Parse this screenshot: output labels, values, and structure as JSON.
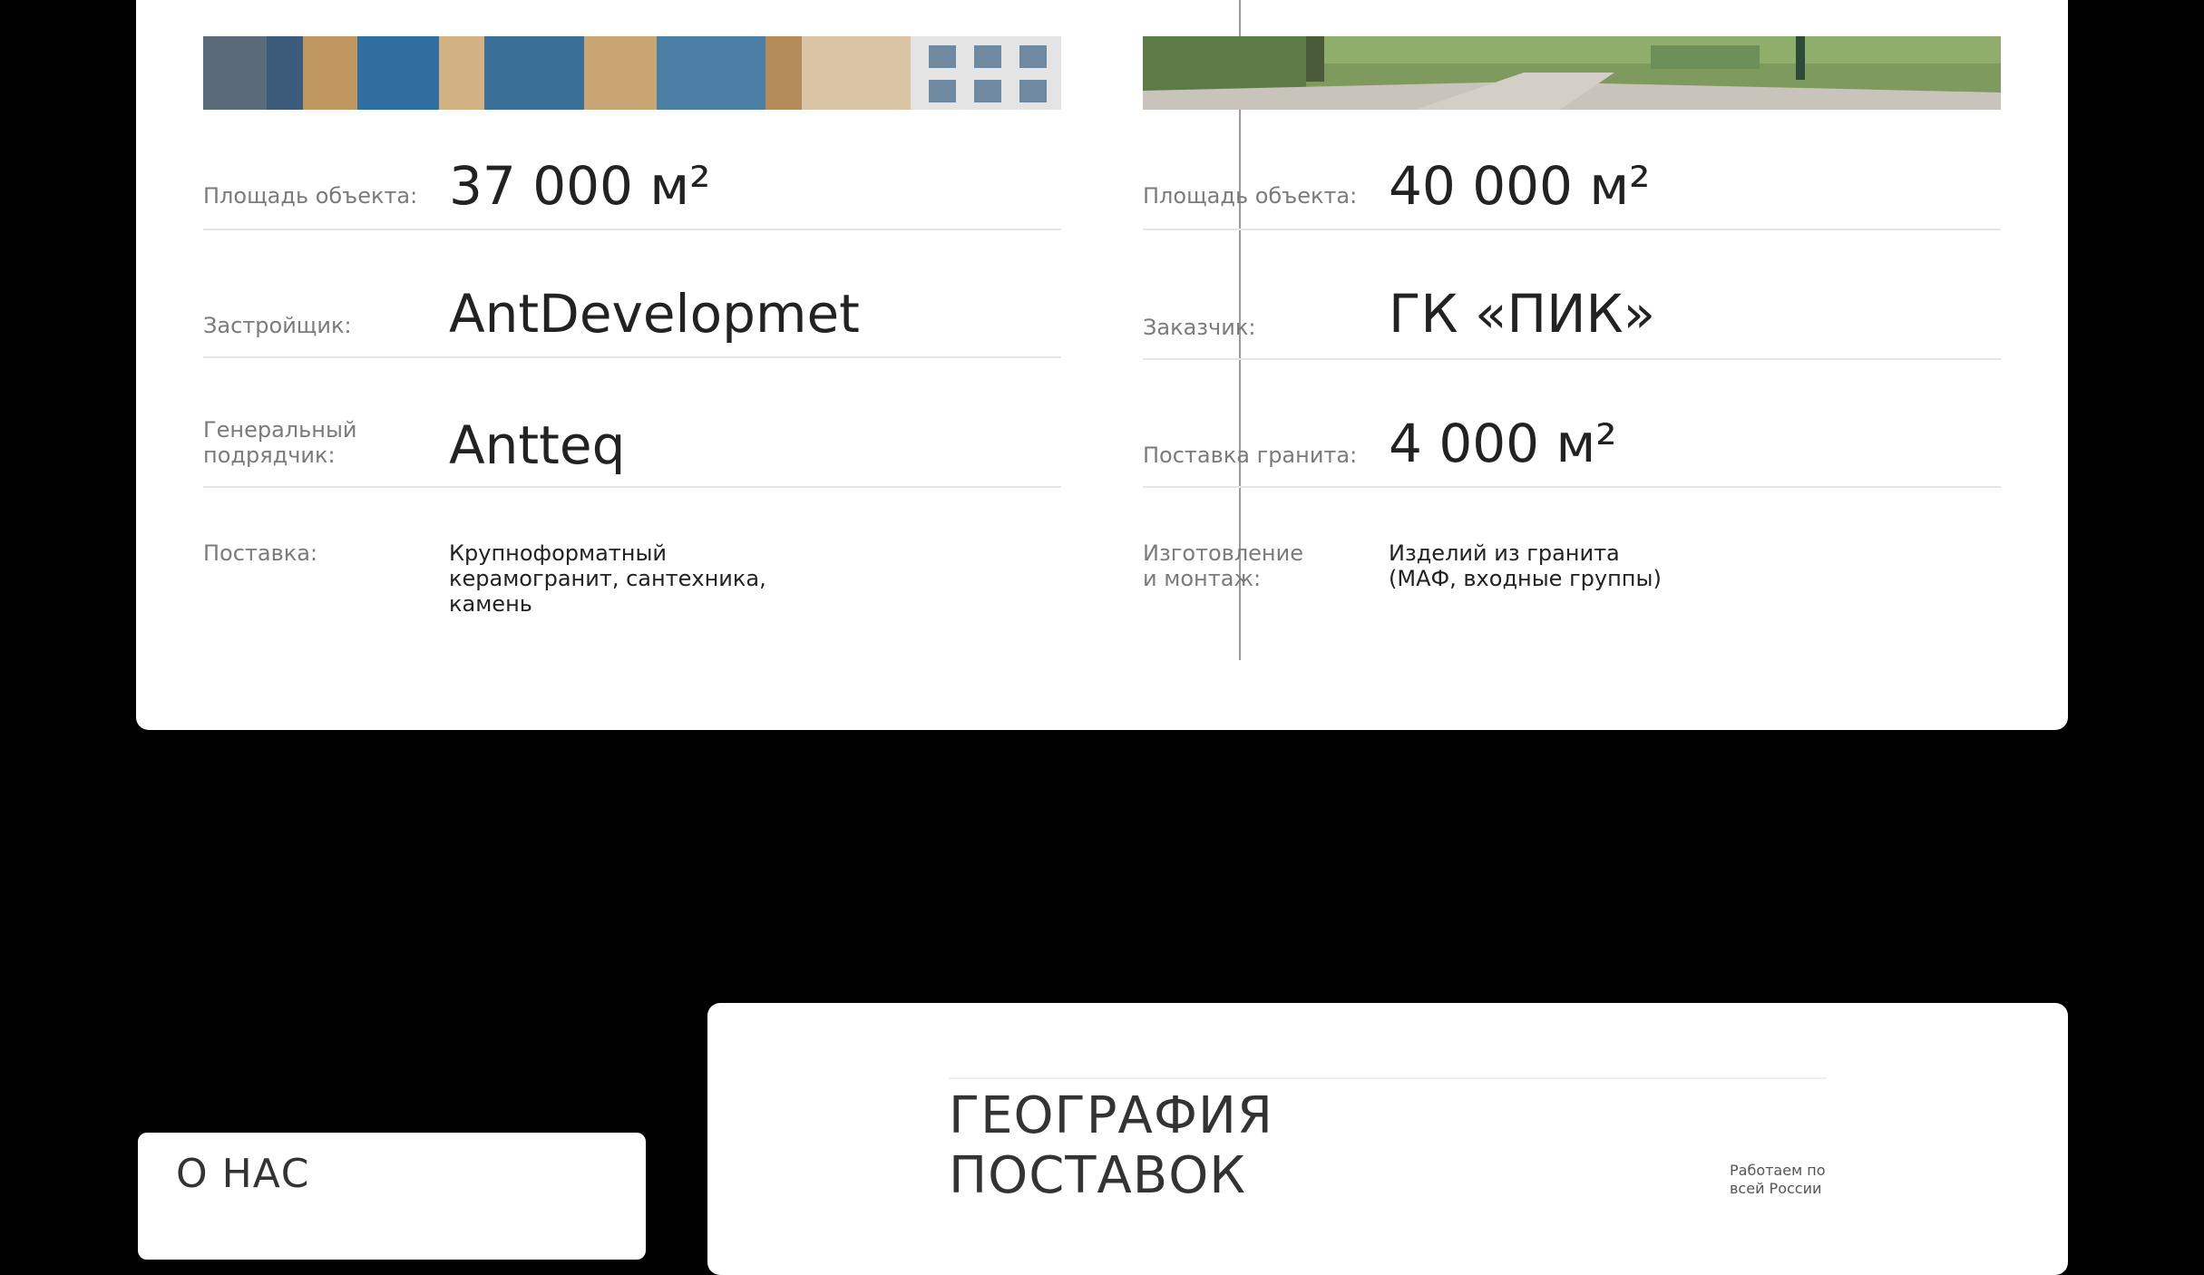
{
  "projects": [
    {
      "rows": [
        {
          "label": "Площадь объекта:",
          "value": "37 000 м²"
        },
        {
          "label": "Застройщик:",
          "value": "AntDevelopmet"
        },
        {
          "label": "Генеральный подрядчик:",
          "value": "Antteq"
        },
        {
          "label": "Поставка:",
          "value": "Крупноформатный керамогранит, сантехника, камень"
        }
      ]
    },
    {
      "rows": [
        {
          "label": "Площадь объекта:",
          "value": "40 000 м²"
        },
        {
          "label": "Заказчик:",
          "value": "ГК «ПИК»"
        },
        {
          "label": "Поставка гранита:",
          "value": "4 000 м²"
        },
        {
          "label": "Изготовление и монтаж:",
          "value": "Изделий из гранита (МАФ, входные группы)"
        }
      ]
    }
  ],
  "about": {
    "title": "О НАС"
  },
  "geography": {
    "title_line1": "ГЕОГРАФИЯ",
    "title_line2": "ПОСТАВОК",
    "note_line1": "Работаем по",
    "note_line2": "всей России"
  }
}
